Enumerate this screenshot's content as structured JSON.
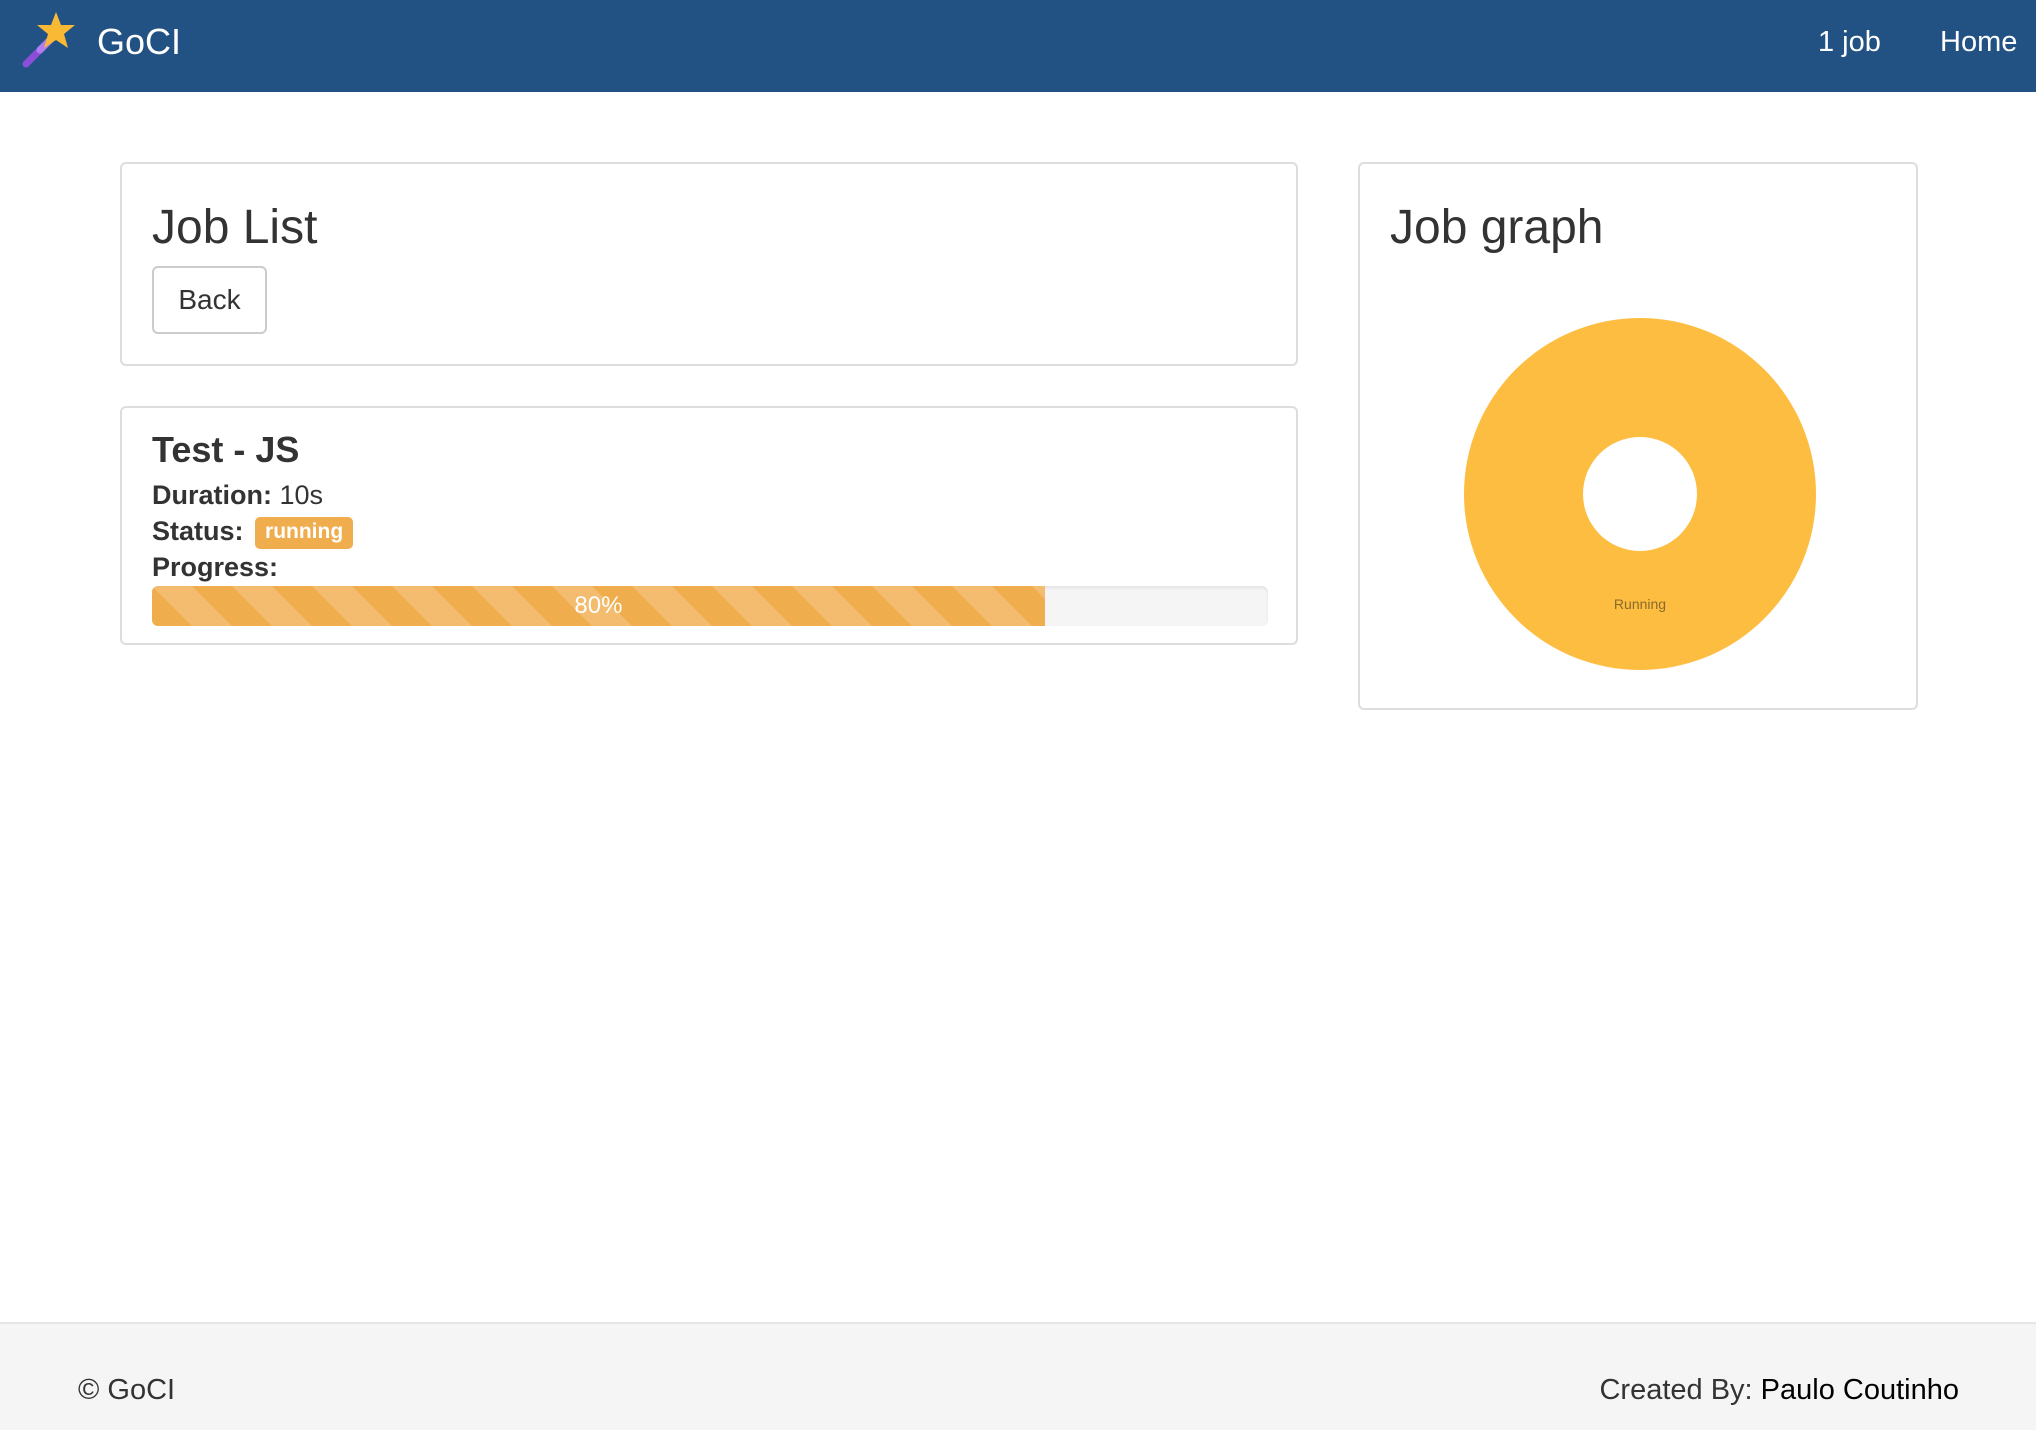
{
  "navbar": {
    "brand": "GoCI",
    "logo_icon": "magic-wand-star-icon",
    "job_count_link": "1 job",
    "home_link": "Home",
    "background": "#225283"
  },
  "job_list": {
    "title": "Job List",
    "back_button": "Back"
  },
  "job": {
    "name": "Test - JS",
    "duration_label": "Duration:",
    "duration_value": "10s",
    "status_label": "Status:",
    "status_value": "running",
    "status_color": "#f0ad4e",
    "progress_label": "Progress:",
    "progress_value": 0.8,
    "progress_text": "80%"
  },
  "job_graph": {
    "title": "Job graph"
  },
  "chart_data": {
    "type": "pie",
    "donut": true,
    "categories": [
      "Running"
    ],
    "values": [
      1
    ],
    "colors": [
      "#fdbd41"
    ],
    "labels": [
      "Running"
    ]
  },
  "footer": {
    "copyright": "© GoCI",
    "created_by_label": "Created By:",
    "author": "Paulo Coutinho"
  }
}
